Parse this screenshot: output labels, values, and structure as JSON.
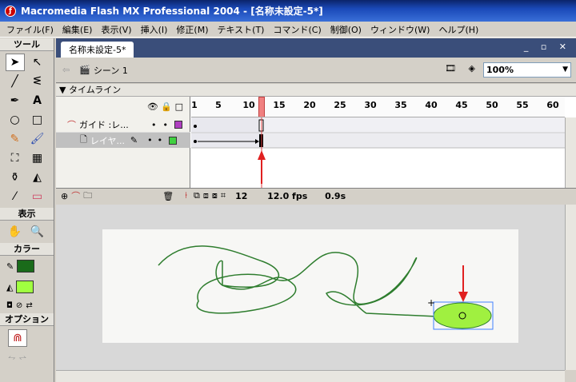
{
  "window": {
    "title": "Macromedia Flash MX Professional 2004 - [名称未設定-5*]"
  },
  "menu": [
    "ファイル(F)",
    "編集(E)",
    "表示(V)",
    "挿入(I)",
    "修正(M)",
    "テキスト(T)",
    "コマンド(C)",
    "制御(O)",
    "ウィンドウ(W)",
    "ヘルプ(H)"
  ],
  "tools": {
    "header": "ツール",
    "view_header": "表示",
    "color_header": "カラー",
    "options_header": "オプション",
    "stroke_color": "#1a6b1a",
    "fill_color": "#a0ff40"
  },
  "document": {
    "tab": "名称未設定-5*",
    "scene": "シーン 1",
    "zoom": "100%"
  },
  "timeline": {
    "header": "タイムライン",
    "layers": [
      {
        "name": "ガイド :レ...",
        "color": "#b040c0"
      },
      {
        "name": "レイヤ...",
        "color": "#40d040"
      }
    ],
    "ruler": [
      "1",
      "5",
      "10",
      "15",
      "20",
      "25",
      "30",
      "35",
      "40",
      "45",
      "50",
      "55",
      "60"
    ],
    "current_frame": "12",
    "fps": "12.0 fps",
    "time": "0.9s"
  }
}
